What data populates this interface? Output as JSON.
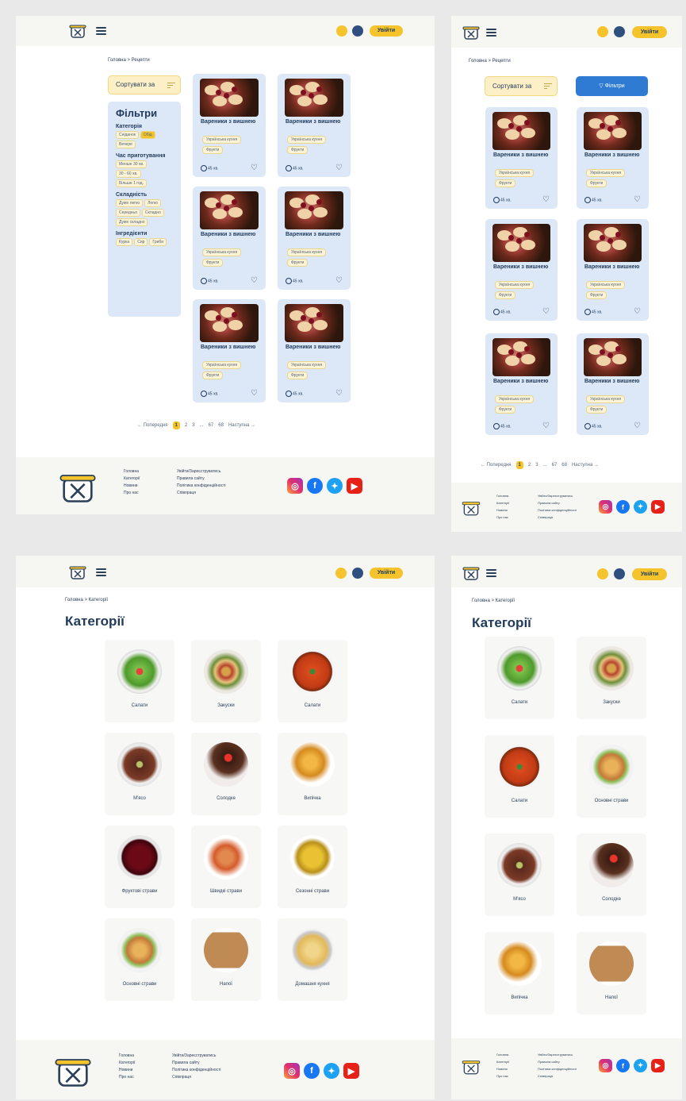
{
  "colors": {
    "accent": "#f5c42c",
    "primary": "#1f3a5a",
    "card_bg": "#dce8f8",
    "filter_button": "#2f7bd4"
  },
  "header": {
    "login_label": "Увійти",
    "search_icon": "search-icon",
    "globe_icon": "globe-icon"
  },
  "recipes_page": {
    "breadcrumb": "Головна > Рецепти",
    "sort_label": "Сортувати за",
    "filters_button": "Фільтри",
    "filters": {
      "title": "Фільтри",
      "groups": [
        {
          "label": "Категорія",
          "options": [
            "Сніданок",
            "Обід",
            "Вечеря"
          ],
          "selected": "Обід"
        },
        {
          "label": "Час приготування",
          "options": [
            "Менше 30 хв.",
            "30 - 60 хв.",
            "Більше 1 год."
          ]
        },
        {
          "label": "Складність",
          "options": [
            "Дуже легко",
            "Легко",
            "Середньо",
            "Складно",
            "Дуже складно"
          ]
        },
        {
          "label": "Інгредієнти",
          "options": [
            "Курка",
            "Сир",
            "Гриби"
          ]
        }
      ]
    },
    "card": {
      "title": "Вареники з вишнею",
      "tag1": "Українська кухня",
      "tag2": "Фрукти",
      "time": "45 хв."
    },
    "pagination": {
      "prev": "← Попередня",
      "pages": [
        "1",
        "2",
        "3",
        "...",
        "67",
        "68"
      ],
      "current": "1",
      "next": "Наступна →"
    }
  },
  "categories_page": {
    "breadcrumb": "Головна > Категорії",
    "title": "Категорії",
    "desktop_items": [
      {
        "label": "Салати",
        "icon": "dish-salad"
      },
      {
        "label": "Закуски",
        "icon": "dish-snack"
      },
      {
        "label": "Салати",
        "icon": "dish-soup"
      },
      {
        "label": "М'ясо",
        "icon": "dish-meat"
      },
      {
        "label": "Солодке",
        "icon": "dish-cake"
      },
      {
        "label": "Випічка",
        "icon": "dish-bread"
      },
      {
        "label": "Фруктові страви",
        "icon": "dish-fruit"
      },
      {
        "label": "Швидкі страви",
        "icon": "dish-fast"
      },
      {
        "label": "Сезонні страви",
        "icon": "dish-corn"
      },
      {
        "label": "Основні страви",
        "icon": "dish-main"
      },
      {
        "label": "Напої",
        "icon": "dish-drink"
      },
      {
        "label": "Домашня кухня",
        "icon": "dish-home"
      }
    ],
    "mobile_items": [
      {
        "label": "Салати",
        "icon": "dish-salad"
      },
      {
        "label": "Закуски",
        "icon": "dish-snack"
      },
      {
        "label": "Салати",
        "icon": "dish-soup"
      },
      {
        "label": "Основні страви",
        "icon": "dish-main"
      },
      {
        "label": "М'ясо",
        "icon": "dish-meat"
      },
      {
        "label": "Солодке",
        "icon": "dish-cake"
      },
      {
        "label": "Випічка",
        "icon": "dish-bread"
      },
      {
        "label": "Напої",
        "icon": "dish-drink"
      }
    ]
  },
  "footer": {
    "col1": [
      "Головна",
      "Категорії",
      "Новини",
      "Про нас"
    ],
    "col2": [
      "Увійти/Зареєструватись",
      "Правила сайту",
      "Політика конфіденційності",
      "Співпраця"
    ],
    "social": [
      "instagram-icon",
      "facebook-icon",
      "twitter-icon",
      "youtube-icon"
    ]
  }
}
